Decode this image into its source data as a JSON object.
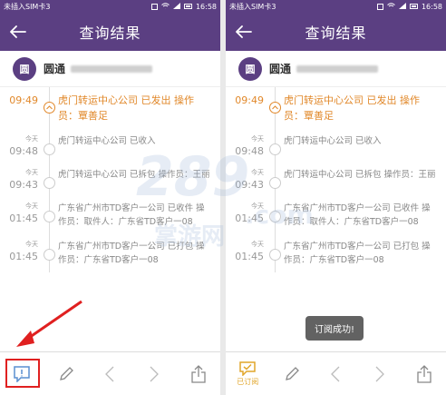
{
  "status_bar": {
    "carrier": "未插入SIM卡3",
    "time": "16:58"
  },
  "app_bar": {
    "title": "查询结果"
  },
  "company": {
    "logo_text": "圆",
    "name": "圆通"
  },
  "events": [
    {
      "day": "",
      "clock": "09:49",
      "text": "虎门转运中心公司 已发出 操作员：覃善足",
      "active": true
    },
    {
      "day": "今天",
      "clock": "09:48",
      "text": "虎门转运中心公司 已收入",
      "active": false
    },
    {
      "day": "今天",
      "clock": "09:43",
      "text": "虎门转运中心公司 已拆包 操作员：王丽",
      "active": false
    },
    {
      "day": "今天",
      "clock": "01:45",
      "text": "广东省广州市TD客户一公司 已收件 操作员：取件人：广东省TD客户一08",
      "active": false
    },
    {
      "day": "今天",
      "clock": "01:45",
      "text": "广东省广州市TD客户一公司 已打包 操作员：广东省TD客户一08",
      "active": false
    }
  ],
  "bottom_bar": {
    "subscribed_label": "已订阅"
  },
  "toast": {
    "text": "订阅成功!"
  },
  "watermark": {
    "line1": "289",
    "line2": ".com",
    "line3": "掌游网"
  },
  "colors": {
    "brand": "#5b3f82",
    "active": "#e1882a",
    "annotation": "#e02020"
  }
}
